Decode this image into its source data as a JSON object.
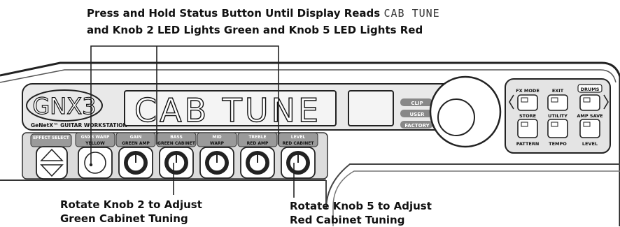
{
  "top_caption": {
    "line1_prefix": "Press and Hold Status Button Until Display Reads",
    "line1_display": "CAB TUNE",
    "line2": "and Knob 2 LED Lights Green and Knob 5 LED Lights Red"
  },
  "device": {
    "logo": "GNX3",
    "brand_line": "GeNetX™ GUITAR WORKSTATION",
    "display_text": "CAB TUNE",
    "status_leds": [
      "CLIP",
      "USER",
      "FACTORY"
    ],
    "effect_select_label": "EFFECT SELECT",
    "knob_sections": [
      {
        "top": "GNX3 WARP",
        "sub": "YELLOW"
      },
      {
        "top": "GAIN",
        "sub": "GREEN AMP"
      },
      {
        "top": "BASS",
        "sub": "GREEN CABINET"
      },
      {
        "top": "MID",
        "sub": "WARP"
      },
      {
        "top": "TREBLE",
        "sub": "RED AMP"
      },
      {
        "top": "LEVEL",
        "sub": "RED CABINET"
      }
    ],
    "buttons": {
      "fx_mode": "FX MODE",
      "exit": "EXIT",
      "drums": "DRUMS",
      "store": "STORE",
      "utility": "UTILITY",
      "amp_save": "AMP SAVE",
      "pattern": "PATTERN",
      "tempo": "TEMPO",
      "level": "LEVEL"
    }
  },
  "bottom_captions": {
    "knob2_line1": "Rotate Knob 2 to Adjust",
    "knob2_line2": "Green Cabinet Tuning",
    "knob5_line1": "Rotate Knob 5 to Adjust",
    "knob5_line2": "Red Cabinet Tuning"
  }
}
